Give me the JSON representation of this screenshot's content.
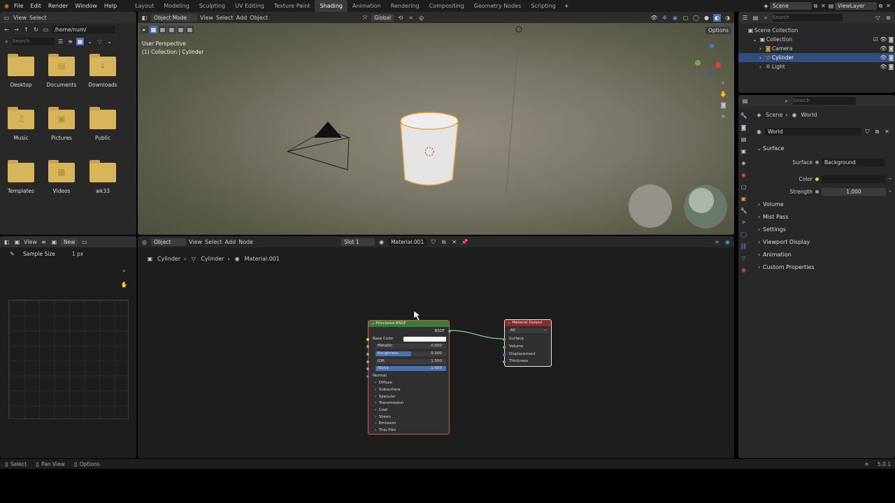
{
  "menu": {
    "file": "File",
    "edit": "Edit",
    "render": "Render",
    "window": "Window",
    "help": "Help"
  },
  "workspaces": [
    "Layout",
    "Modeling",
    "Sculpting",
    "UV Editing",
    "Texture Paint",
    "Shading",
    "Animation",
    "Rendering",
    "Compositing",
    "Geometry Nodes",
    "Scripting"
  ],
  "active_workspace": "Shading",
  "scene": {
    "label": "Scene",
    "view_layer": "ViewLayer"
  },
  "file_browser": {
    "view": "View",
    "select": "Select",
    "path": "/home/num/",
    "search_placeholder": "Search",
    "folders": [
      {
        "name": "Desktop",
        "icon": "folder-icon",
        "glyph": ""
      },
      {
        "name": "Documents",
        "icon": "documents-folder-icon",
        "glyph": "▤"
      },
      {
        "name": "Downloads",
        "icon": "downloads-folder-icon",
        "glyph": "↓"
      },
      {
        "name": "Music",
        "icon": "music-folder-icon",
        "glyph": "♫"
      },
      {
        "name": "Pictures",
        "icon": "pictures-folder-icon",
        "glyph": "▣"
      },
      {
        "name": "Public",
        "icon": "folder-icon",
        "glyph": ""
      },
      {
        "name": "Templates",
        "icon": "folder-icon",
        "glyph": ""
      },
      {
        "name": "Videos",
        "icon": "videos-folder-icon",
        "glyph": "▦"
      },
      {
        "name": "wk33",
        "icon": "folder-icon",
        "glyph": ""
      }
    ]
  },
  "viewport": {
    "mode": "Object Mode",
    "view": "View",
    "select": "Select",
    "add": "Add",
    "object": "Object",
    "orientation": "Global",
    "options": "Options",
    "perspective": "User Perspective",
    "collection_info": "(1) Collection | Cylinder"
  },
  "outliner": {
    "search_placeholder": "Search",
    "items": [
      {
        "name": "Scene Collection",
        "depth": 0
      },
      {
        "name": "Collection",
        "depth": 1
      },
      {
        "name": "Camera",
        "depth": 2
      },
      {
        "name": "Cylinder",
        "depth": 2,
        "selected": true
      },
      {
        "name": "Light",
        "depth": 2
      }
    ]
  },
  "properties": {
    "search_placeholder": "Search",
    "breadcrumb": {
      "scene": "Scene",
      "world": "World"
    },
    "world_name": "World",
    "surface_section": "Surface",
    "surface_label": "Surface",
    "surface_value": "Background",
    "color_label": "Color",
    "strength_label": "Strength",
    "strength_value": "1.000",
    "sections": [
      "Volume",
      "Mist Pass",
      "Settings",
      "Viewport Display",
      "Animation",
      "Custom Properties"
    ]
  },
  "image_editor": {
    "view": "View",
    "new": "New",
    "sample_label": "Sample Size",
    "sample_value": "1 px"
  },
  "node_editor": {
    "object": "Object",
    "view": "View",
    "select": "Select",
    "add": "Add",
    "node": "Node",
    "slot": "Slot 1",
    "material": "Material.001",
    "breadcrumb": {
      "object": "Cylinder",
      "mesh": "Cylinder",
      "material": "Material.001"
    },
    "bsdf": {
      "title": "Principled BSDF",
      "output": "BSDF",
      "inputs": [
        {
          "label": "Base Color",
          "value": ""
        },
        {
          "label": "Metallic",
          "value": "0.000"
        },
        {
          "label": "Roughness",
          "value": "0.500"
        },
        {
          "label": "IOR",
          "value": "1.500"
        },
        {
          "label": "Alpha",
          "value": "1.000"
        }
      ],
      "normal": "Normal",
      "panels": [
        "Diffuse",
        "Subsurface",
        "Specular",
        "Transmission",
        "Coat",
        "Sheen",
        "Emission",
        "Thin Film"
      ]
    },
    "output_node": {
      "title": "Material Output",
      "target": "All",
      "inputs": [
        "Surface",
        "Volume",
        "Displacement",
        "Thickness"
      ]
    }
  },
  "statusbar": {
    "select": "Select",
    "pan": "Pan View",
    "options": "Options",
    "version": "5.0.1"
  },
  "colors": {
    "accent": "#4772b3",
    "bsdf_header": "#3a7b3a",
    "output_header": "#8a2a2a",
    "folder": "#d8b45a"
  }
}
